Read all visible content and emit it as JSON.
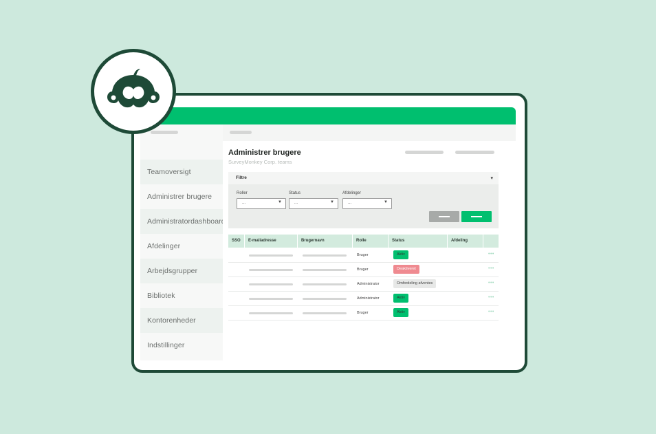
{
  "colors": {
    "background": "#cde9dd",
    "brand_green": "#00bf6f",
    "dark_green": "#1e4a37",
    "status_active": "#00bf6f",
    "status_deactivated": "#ef8a90"
  },
  "logo": {
    "icon": "surveymonkey-monkey-icon"
  },
  "sidebar": {
    "items": [
      {
        "label": "Teamoversigt"
      },
      {
        "label": "Administrer brugere"
      },
      {
        "label": "Administratordashboard"
      },
      {
        "label": "Afdelinger"
      },
      {
        "label": "Arbejdsgrupper"
      },
      {
        "label": "Bibliotek"
      },
      {
        "label": "Kontorenheder"
      },
      {
        "label": "Indstillinger"
      }
    ]
  },
  "main": {
    "title": "Administrer brugere",
    "subtitle": "SurveyMonkey Corp. teams"
  },
  "filters": {
    "title": "Filtre",
    "caret": "▾",
    "role_label": "Roller",
    "role_value": "...",
    "status_label": "Status",
    "status_value": "...",
    "dept_label": "Afdelinger",
    "dept_value": "..."
  },
  "table": {
    "columns": [
      "SSO",
      "E-mailadresse",
      "Brugernavn",
      "Rolle",
      "Status",
      "Afdeling"
    ],
    "rows": [
      {
        "role": "Bruger",
        "status": "Aktiv"
      },
      {
        "role": "Bruger",
        "status": "Deaktiveret"
      },
      {
        "role": "Administrator",
        "status": "Omfordeling afventes"
      },
      {
        "role": "Administrator",
        "status": "Aktiv"
      },
      {
        "role": "Bruger",
        "status": "Aktiv"
      }
    ],
    "row_menu": "•••"
  }
}
